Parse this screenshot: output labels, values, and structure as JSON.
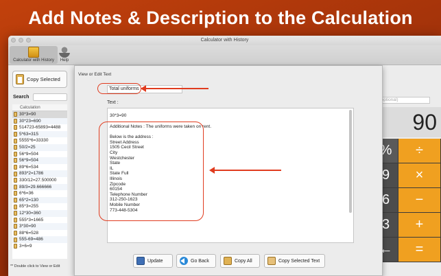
{
  "headline": "Add Notes & Description to the Calculation",
  "window": {
    "title": "Calculator with History",
    "toolbar": {
      "calc_label": "Calculator with History",
      "help_label": "Help"
    }
  },
  "left_panel": {
    "copy_selected_label": "Copy Selected",
    "search_label": "Search",
    "column_header": "Calculation",
    "history": [
      "30*3=90",
      "30*23=690",
      "514723-65893=4488",
      "5*63=315",
      "5555*6=33330",
      "50/2=25",
      "56*9=504",
      "56*9=504",
      "89*6=534",
      "893*2=1786",
      "330/12=27.500000",
      "89/3=29.666666",
      "6*6=36",
      "65*2=130",
      "85*3=255",
      "12*30=360",
      "555*3=1665",
      "3*30=90",
      "88*6=528",
      "555-69=486",
      "3+6=9"
    ],
    "footnote": "** Double click to View or Edit"
  },
  "sheet": {
    "section_title": "View or Edit Text",
    "title_value": "Total uniforms",
    "text_label": "Text :",
    "first_line": "30*3=90",
    "notes_lines": [
      "Additional Notes : The uniforms were taken on rent.",
      "",
      "Below is the address :",
      "Street Address",
      "1505 Cecil Street",
      "City",
      "Westchester",
      "State",
      "IL",
      "State Full",
      "Illinois",
      "Zipcode",
      "60154",
      "Telephone Number",
      "312-250-1623",
      "Mobile Number",
      "773-448-5304"
    ],
    "buttons": {
      "update": "Update",
      "go_back": "Go Back",
      "copy_all": "Copy All",
      "copy_selected_text": "Copy Selected Text"
    }
  },
  "calculator": {
    "optional_placeholder": "n (optional)",
    "display": "90",
    "keys": [
      "%",
      "÷",
      "9",
      "×",
      "6",
      "−",
      "3",
      "+",
      "←",
      "="
    ]
  },
  "colors": {
    "annotation": "#e03b1e",
    "operator_key": "#f0a020",
    "background": "#a2320a"
  }
}
